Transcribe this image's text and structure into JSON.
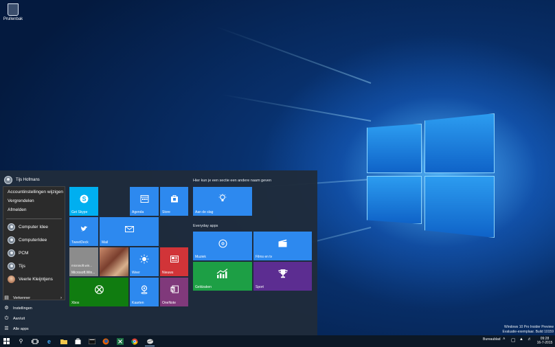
{
  "desktop": {
    "recycle_bin_label": "Prullenbak"
  },
  "start_menu": {
    "user": {
      "name": "Tijs Hofmans"
    },
    "user_flyout": {
      "actions": [
        "Accountinstellingen wijzigen",
        "Vergrendelen",
        "Afmelden"
      ],
      "accounts": [
        "Computer Idee",
        "ComputerIdee",
        "PCM",
        "Tijs",
        "Veerle Kleijntjens"
      ]
    },
    "nav": [
      {
        "label": "Verkenner",
        "icon": "folder-icon",
        "has_submenu": true
      },
      {
        "label": "Instellingen",
        "icon": "gear-icon",
        "has_submenu": false
      },
      {
        "label": "Aan/uit",
        "icon": "power-icon",
        "has_submenu": false
      },
      {
        "label": "Alle apps",
        "icon": "list-icon",
        "has_submenu": false
      }
    ],
    "tiles": {
      "skype": "Get Skype",
      "agenda": "Agenda",
      "store": "Store",
      "tweetdeck": "TweetDeck",
      "mail": "Mail",
      "news_small_text": "microsoft.win...",
      "news_small_label": "Microsoft.Win...",
      "weer": "Weer",
      "nieuws": "Nieuws",
      "xbox": "Xbox",
      "kaarten": "Kaarten",
      "onenote": "OneNote"
    },
    "group_heading_1": "Hier kun je een sectie een andere naam geven",
    "group1_tiles": {
      "aan_de_slag": "Aan de slag"
    },
    "group_heading_2": "Everyday apps",
    "group2_tiles": {
      "muziek": "Muziek",
      "films": "Films en tv",
      "geldzaken": "Geldzaken",
      "sport": "Sport"
    }
  },
  "watermark": {
    "line1": "Windows 10 Pro Insider Preview",
    "line2": "Evaluatie-exemplaar. Build 10159"
  },
  "taskbar": {
    "desktop_label": "Bureaublad",
    "time": "09:28",
    "date": "16-7-2015"
  },
  "colors": {
    "accent": "#2d89ef",
    "skype": "#00aff0",
    "xbox": "#107c10",
    "news": "#d13438",
    "onenote": "#80397b",
    "finance": "#1d9f45",
    "sport": "#5c2d91",
    "start_bg": "#1f2c3b"
  }
}
